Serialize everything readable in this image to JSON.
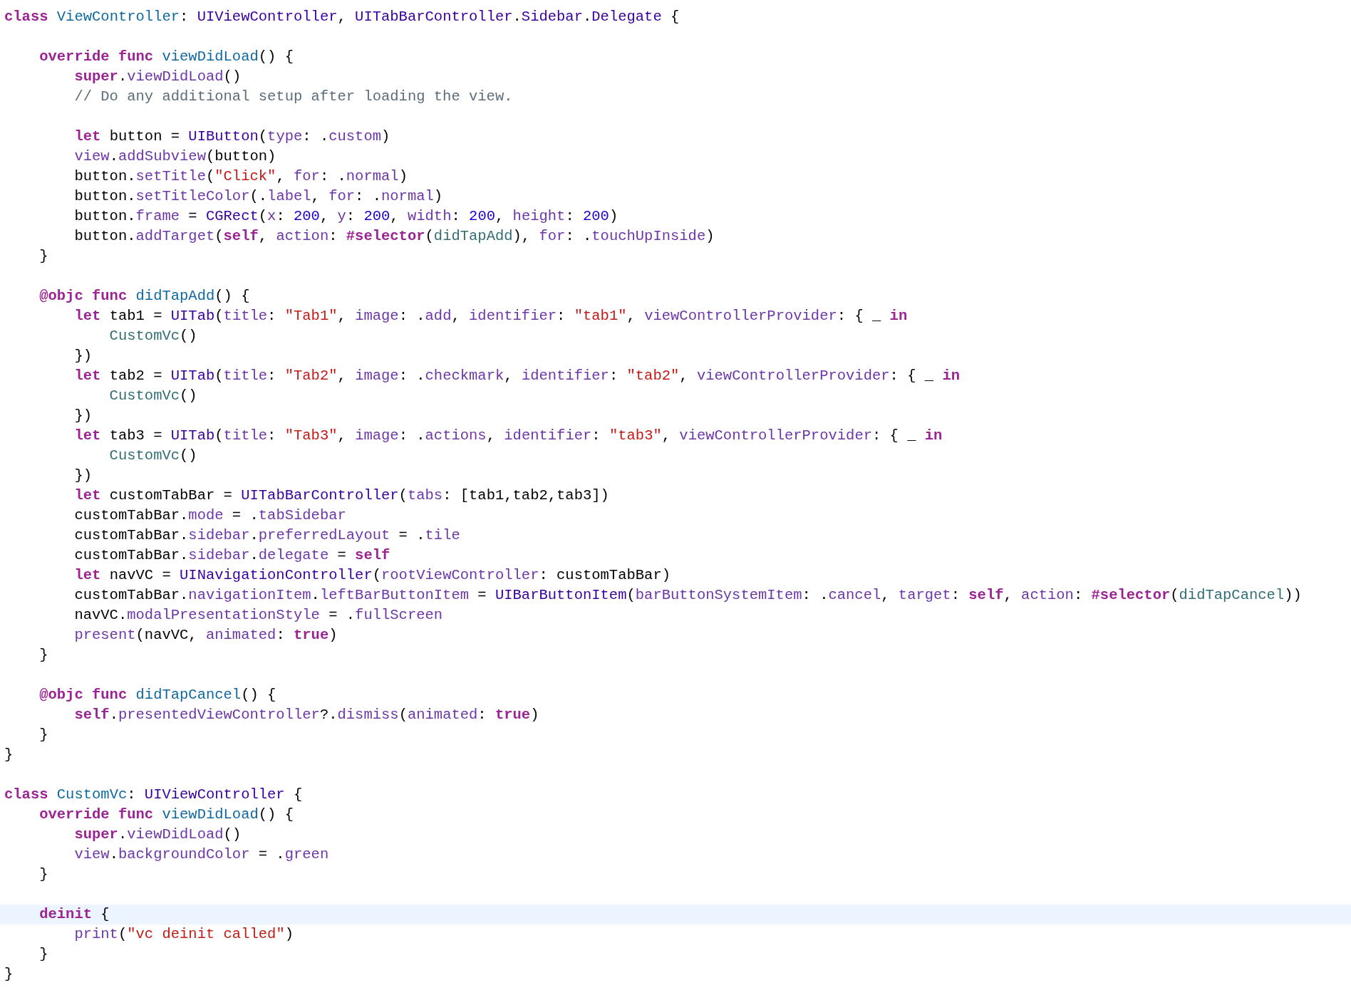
{
  "lines": [
    {
      "current": false,
      "tokens": [
        {
          "kind": "keyword",
          "text": "class"
        },
        {
          "kind": "declaration",
          "text": " ViewController"
        },
        {
          "kind": "plain",
          "text": ": "
        },
        {
          "kind": "type",
          "text": "UIViewController"
        },
        {
          "kind": "plain",
          "text": ", "
        },
        {
          "kind": "type",
          "text": "UITabBarController"
        },
        {
          "kind": "plain",
          "text": "."
        },
        {
          "kind": "type",
          "text": "Sidebar"
        },
        {
          "kind": "plain",
          "text": "."
        },
        {
          "kind": "type",
          "text": "Delegate"
        },
        {
          "kind": "plain",
          "text": " {"
        }
      ]
    },
    {
      "current": false
    },
    {
      "current": false,
      "tokens": [
        {
          "kind": "keyword",
          "text": "    override func"
        },
        {
          "kind": "declaration",
          "text": " viewDidLoad"
        },
        {
          "kind": "plain",
          "text": "() {"
        }
      ]
    },
    {
      "current": false,
      "tokens": [
        {
          "kind": "keyword",
          "text": "        super"
        },
        {
          "kind": "plain",
          "text": "."
        },
        {
          "kind": "member",
          "text": "viewDidLoad"
        },
        {
          "kind": "plain",
          "text": "()"
        }
      ]
    },
    {
      "current": false,
      "tokens": [
        {
          "kind": "comment",
          "text": "        // Do any additional setup after loading the view."
        }
      ]
    },
    {
      "current": false
    },
    {
      "current": false,
      "tokens": [
        {
          "kind": "keyword",
          "text": "        let"
        },
        {
          "kind": "plain",
          "text": " button = "
        },
        {
          "kind": "type",
          "text": "UIButton"
        },
        {
          "kind": "plain",
          "text": "("
        },
        {
          "kind": "member",
          "text": "type"
        },
        {
          "kind": "plain",
          "text": ": ."
        },
        {
          "kind": "member",
          "text": "custom"
        },
        {
          "kind": "plain",
          "text": ")"
        }
      ]
    },
    {
      "current": false,
      "tokens": [
        {
          "kind": "member",
          "text": "        view"
        },
        {
          "kind": "plain",
          "text": "."
        },
        {
          "kind": "member",
          "text": "addSubview"
        },
        {
          "kind": "plain",
          "text": "(button)"
        }
      ]
    },
    {
      "current": false,
      "tokens": [
        {
          "kind": "plain",
          "text": "        button."
        },
        {
          "kind": "member",
          "text": "setTitle"
        },
        {
          "kind": "plain",
          "text": "("
        },
        {
          "kind": "string",
          "text": "\"Click\""
        },
        {
          "kind": "plain",
          "text": ", "
        },
        {
          "kind": "member",
          "text": "for"
        },
        {
          "kind": "plain",
          "text": ": ."
        },
        {
          "kind": "member",
          "text": "normal"
        },
        {
          "kind": "plain",
          "text": ")"
        }
      ]
    },
    {
      "current": false,
      "tokens": [
        {
          "kind": "plain",
          "text": "        button."
        },
        {
          "kind": "member",
          "text": "setTitleColor"
        },
        {
          "kind": "plain",
          "text": "(."
        },
        {
          "kind": "member",
          "text": "label"
        },
        {
          "kind": "plain",
          "text": ", "
        },
        {
          "kind": "member",
          "text": "for"
        },
        {
          "kind": "plain",
          "text": ": ."
        },
        {
          "kind": "member",
          "text": "normal"
        },
        {
          "kind": "plain",
          "text": ")"
        }
      ]
    },
    {
      "current": false,
      "tokens": [
        {
          "kind": "plain",
          "text": "        button."
        },
        {
          "kind": "member",
          "text": "frame"
        },
        {
          "kind": "plain",
          "text": " = "
        },
        {
          "kind": "type",
          "text": "CGRect"
        },
        {
          "kind": "plain",
          "text": "("
        },
        {
          "kind": "member",
          "text": "x"
        },
        {
          "kind": "plain",
          "text": ": "
        },
        {
          "kind": "number",
          "text": "200"
        },
        {
          "kind": "plain",
          "text": ", "
        },
        {
          "kind": "member",
          "text": "y"
        },
        {
          "kind": "plain",
          "text": ": "
        },
        {
          "kind": "number",
          "text": "200"
        },
        {
          "kind": "plain",
          "text": ", "
        },
        {
          "kind": "member",
          "text": "width"
        },
        {
          "kind": "plain",
          "text": ": "
        },
        {
          "kind": "number",
          "text": "200"
        },
        {
          "kind": "plain",
          "text": ", "
        },
        {
          "kind": "member",
          "text": "height"
        },
        {
          "kind": "plain",
          "text": ": "
        },
        {
          "kind": "number",
          "text": "200"
        },
        {
          "kind": "plain",
          "text": ")"
        }
      ]
    },
    {
      "current": false,
      "tokens": [
        {
          "kind": "plain",
          "text": "        button."
        },
        {
          "kind": "member",
          "text": "addTarget"
        },
        {
          "kind": "plain",
          "text": "("
        },
        {
          "kind": "keyword",
          "text": "self"
        },
        {
          "kind": "plain",
          "text": ", "
        },
        {
          "kind": "member",
          "text": "action"
        },
        {
          "kind": "plain",
          "text": ": "
        },
        {
          "kind": "keyword",
          "text": "#selector"
        },
        {
          "kind": "plain",
          "text": "("
        },
        {
          "kind": "project",
          "text": "didTapAdd"
        },
        {
          "kind": "plain",
          "text": "), "
        },
        {
          "kind": "member",
          "text": "for"
        },
        {
          "kind": "plain",
          "text": ": ."
        },
        {
          "kind": "member",
          "text": "touchUpInside"
        },
        {
          "kind": "plain",
          "text": ")"
        }
      ]
    },
    {
      "current": false,
      "tokens": [
        {
          "kind": "plain",
          "text": "    }"
        }
      ]
    },
    {
      "current": false
    },
    {
      "current": false,
      "tokens": [
        {
          "kind": "keyword",
          "text": "    @objc func"
        },
        {
          "kind": "declaration",
          "text": " didTapAdd"
        },
        {
          "kind": "plain",
          "text": "() {"
        }
      ]
    },
    {
      "current": false,
      "tokens": [
        {
          "kind": "keyword",
          "text": "        let"
        },
        {
          "kind": "plain",
          "text": " tab1 = "
        },
        {
          "kind": "type",
          "text": "UITab"
        },
        {
          "kind": "plain",
          "text": "("
        },
        {
          "kind": "member",
          "text": "title"
        },
        {
          "kind": "plain",
          "text": ": "
        },
        {
          "kind": "string",
          "text": "\"Tab1\""
        },
        {
          "kind": "plain",
          "text": ", "
        },
        {
          "kind": "member",
          "text": "image"
        },
        {
          "kind": "plain",
          "text": ": ."
        },
        {
          "kind": "member",
          "text": "add"
        },
        {
          "kind": "plain",
          "text": ", "
        },
        {
          "kind": "member",
          "text": "identifier"
        },
        {
          "kind": "plain",
          "text": ": "
        },
        {
          "kind": "string",
          "text": "\"tab1\""
        },
        {
          "kind": "plain",
          "text": ", "
        },
        {
          "kind": "member",
          "text": "viewControllerProvider"
        },
        {
          "kind": "plain",
          "text": ": { _ "
        },
        {
          "kind": "keyword",
          "text": "in"
        }
      ]
    },
    {
      "current": false,
      "tokens": [
        {
          "kind": "project",
          "text": "            CustomVc"
        },
        {
          "kind": "plain",
          "text": "()"
        }
      ]
    },
    {
      "current": false,
      "tokens": [
        {
          "kind": "plain",
          "text": "        })"
        }
      ]
    },
    {
      "current": false,
      "tokens": [
        {
          "kind": "keyword",
          "text": "        let"
        },
        {
          "kind": "plain",
          "text": " tab2 = "
        },
        {
          "kind": "type",
          "text": "UITab"
        },
        {
          "kind": "plain",
          "text": "("
        },
        {
          "kind": "member",
          "text": "title"
        },
        {
          "kind": "plain",
          "text": ": "
        },
        {
          "kind": "string",
          "text": "\"Tab2\""
        },
        {
          "kind": "plain",
          "text": ", "
        },
        {
          "kind": "member",
          "text": "image"
        },
        {
          "kind": "plain",
          "text": ": ."
        },
        {
          "kind": "member",
          "text": "checkmark"
        },
        {
          "kind": "plain",
          "text": ", "
        },
        {
          "kind": "member",
          "text": "identifier"
        },
        {
          "kind": "plain",
          "text": ": "
        },
        {
          "kind": "string",
          "text": "\"tab2\""
        },
        {
          "kind": "plain",
          "text": ", "
        },
        {
          "kind": "member",
          "text": "viewControllerProvider"
        },
        {
          "kind": "plain",
          "text": ": { _ "
        },
        {
          "kind": "keyword",
          "text": "in"
        }
      ]
    },
    {
      "current": false,
      "tokens": [
        {
          "kind": "project",
          "text": "            CustomVc"
        },
        {
          "kind": "plain",
          "text": "()"
        }
      ]
    },
    {
      "current": false,
      "tokens": [
        {
          "kind": "plain",
          "text": "        })"
        }
      ]
    },
    {
      "current": false,
      "tokens": [
        {
          "kind": "keyword",
          "text": "        let"
        },
        {
          "kind": "plain",
          "text": " tab3 = "
        },
        {
          "kind": "type",
          "text": "UITab"
        },
        {
          "kind": "plain",
          "text": "("
        },
        {
          "kind": "member",
          "text": "title"
        },
        {
          "kind": "plain",
          "text": ": "
        },
        {
          "kind": "string",
          "text": "\"Tab3\""
        },
        {
          "kind": "plain",
          "text": ", "
        },
        {
          "kind": "member",
          "text": "image"
        },
        {
          "kind": "plain",
          "text": ": ."
        },
        {
          "kind": "member",
          "text": "actions"
        },
        {
          "kind": "plain",
          "text": ", "
        },
        {
          "kind": "member",
          "text": "identifier"
        },
        {
          "kind": "plain",
          "text": ": "
        },
        {
          "kind": "string",
          "text": "\"tab3\""
        },
        {
          "kind": "plain",
          "text": ", "
        },
        {
          "kind": "member",
          "text": "viewControllerProvider"
        },
        {
          "kind": "plain",
          "text": ": { _ "
        },
        {
          "kind": "keyword",
          "text": "in"
        }
      ]
    },
    {
      "current": false,
      "tokens": [
        {
          "kind": "project",
          "text": "            CustomVc"
        },
        {
          "kind": "plain",
          "text": "()"
        }
      ]
    },
    {
      "current": false,
      "tokens": [
        {
          "kind": "plain",
          "text": "        })"
        }
      ]
    },
    {
      "current": false,
      "tokens": [
        {
          "kind": "keyword",
          "text": "        let"
        },
        {
          "kind": "plain",
          "text": " customTabBar = "
        },
        {
          "kind": "type",
          "text": "UITabBarController"
        },
        {
          "kind": "plain",
          "text": "("
        },
        {
          "kind": "member",
          "text": "tabs"
        },
        {
          "kind": "plain",
          "text": ": [tab1,tab2,tab3])"
        }
      ]
    },
    {
      "current": false,
      "tokens": [
        {
          "kind": "plain",
          "text": "        customTabBar."
        },
        {
          "kind": "member",
          "text": "mode"
        },
        {
          "kind": "plain",
          "text": " = ."
        },
        {
          "kind": "member",
          "text": "tabSidebar"
        }
      ]
    },
    {
      "current": false,
      "tokens": [
        {
          "kind": "plain",
          "text": "        customTabBar."
        },
        {
          "kind": "member",
          "text": "sidebar"
        },
        {
          "kind": "plain",
          "text": "."
        },
        {
          "kind": "member",
          "text": "preferredLayout"
        },
        {
          "kind": "plain",
          "text": " = ."
        },
        {
          "kind": "member",
          "text": "tile"
        }
      ]
    },
    {
      "current": false,
      "tokens": [
        {
          "kind": "plain",
          "text": "        customTabBar."
        },
        {
          "kind": "member",
          "text": "sidebar"
        },
        {
          "kind": "plain",
          "text": "."
        },
        {
          "kind": "member",
          "text": "delegate"
        },
        {
          "kind": "plain",
          "text": " = "
        },
        {
          "kind": "keyword",
          "text": "self"
        }
      ]
    },
    {
      "current": false,
      "tokens": [
        {
          "kind": "keyword",
          "text": "        let"
        },
        {
          "kind": "plain",
          "text": " navVC = "
        },
        {
          "kind": "type",
          "text": "UINavigationController"
        },
        {
          "kind": "plain",
          "text": "("
        },
        {
          "kind": "member",
          "text": "rootViewController"
        },
        {
          "kind": "plain",
          "text": ": customTabBar)"
        }
      ]
    },
    {
      "current": false,
      "tokens": [
        {
          "kind": "plain",
          "text": "        customTabBar."
        },
        {
          "kind": "member",
          "text": "navigationItem"
        },
        {
          "kind": "plain",
          "text": "."
        },
        {
          "kind": "member",
          "text": "leftBarButtonItem"
        },
        {
          "kind": "plain",
          "text": " = "
        },
        {
          "kind": "type",
          "text": "UIBarButtonItem"
        },
        {
          "kind": "plain",
          "text": "("
        },
        {
          "kind": "member",
          "text": "barButtonSystemItem"
        },
        {
          "kind": "plain",
          "text": ": ."
        },
        {
          "kind": "member",
          "text": "cancel"
        },
        {
          "kind": "plain",
          "text": ", "
        },
        {
          "kind": "member",
          "text": "target"
        },
        {
          "kind": "plain",
          "text": ": "
        },
        {
          "kind": "keyword",
          "text": "self"
        },
        {
          "kind": "plain",
          "text": ", "
        },
        {
          "kind": "member",
          "text": "action"
        },
        {
          "kind": "plain",
          "text": ": "
        },
        {
          "kind": "keyword",
          "text": "#selector"
        },
        {
          "kind": "plain",
          "text": "("
        },
        {
          "kind": "project",
          "text": "didTapCancel"
        },
        {
          "kind": "plain",
          "text": "))"
        }
      ]
    },
    {
      "current": false,
      "tokens": [
        {
          "kind": "plain",
          "text": "        navVC."
        },
        {
          "kind": "member",
          "text": "modalPresentationStyle"
        },
        {
          "kind": "plain",
          "text": " = ."
        },
        {
          "kind": "member",
          "text": "fullScreen"
        }
      ]
    },
    {
      "current": false,
      "tokens": [
        {
          "kind": "member",
          "text": "        present"
        },
        {
          "kind": "plain",
          "text": "(navVC, "
        },
        {
          "kind": "member",
          "text": "animated"
        },
        {
          "kind": "plain",
          "text": ": "
        },
        {
          "kind": "keyword",
          "text": "true"
        },
        {
          "kind": "plain",
          "text": ")"
        }
      ]
    },
    {
      "current": false,
      "tokens": [
        {
          "kind": "plain",
          "text": "    }"
        }
      ]
    },
    {
      "current": false
    },
    {
      "current": false,
      "tokens": [
        {
          "kind": "keyword",
          "text": "    @objc func"
        },
        {
          "kind": "declaration",
          "text": " didTapCancel"
        },
        {
          "kind": "plain",
          "text": "() {"
        }
      ]
    },
    {
      "current": false,
      "tokens": [
        {
          "kind": "keyword",
          "text": "        self"
        },
        {
          "kind": "plain",
          "text": "."
        },
        {
          "kind": "member",
          "text": "presentedViewController"
        },
        {
          "kind": "plain",
          "text": "?."
        },
        {
          "kind": "member",
          "text": "dismiss"
        },
        {
          "kind": "plain",
          "text": "("
        },
        {
          "kind": "member",
          "text": "animated"
        },
        {
          "kind": "plain",
          "text": ": "
        },
        {
          "kind": "keyword",
          "text": "true"
        },
        {
          "kind": "plain",
          "text": ")"
        }
      ]
    },
    {
      "current": false,
      "tokens": [
        {
          "kind": "plain",
          "text": "    }"
        }
      ]
    },
    {
      "current": false,
      "tokens": [
        {
          "kind": "plain",
          "text": "}"
        }
      ]
    },
    {
      "current": false
    },
    {
      "current": false,
      "tokens": [
        {
          "kind": "keyword",
          "text": "class"
        },
        {
          "kind": "declaration",
          "text": " CustomVc"
        },
        {
          "kind": "plain",
          "text": ": "
        },
        {
          "kind": "type",
          "text": "UIViewController"
        },
        {
          "kind": "plain",
          "text": " {"
        }
      ]
    },
    {
      "current": false,
      "tokens": [
        {
          "kind": "keyword",
          "text": "    override func"
        },
        {
          "kind": "declaration",
          "text": " viewDidLoad"
        },
        {
          "kind": "plain",
          "text": "() {"
        }
      ]
    },
    {
      "current": false,
      "tokens": [
        {
          "kind": "keyword",
          "text": "        super"
        },
        {
          "kind": "plain",
          "text": "."
        },
        {
          "kind": "member",
          "text": "viewDidLoad"
        },
        {
          "kind": "plain",
          "text": "()"
        }
      ]
    },
    {
      "current": false,
      "tokens": [
        {
          "kind": "member",
          "text": "        view"
        },
        {
          "kind": "plain",
          "text": "."
        },
        {
          "kind": "member",
          "text": "backgroundColor"
        },
        {
          "kind": "plain",
          "text": " = ."
        },
        {
          "kind": "member",
          "text": "green"
        }
      ]
    },
    {
      "current": false,
      "tokens": [
        {
          "kind": "plain",
          "text": "    }"
        }
      ]
    },
    {
      "current": false
    },
    {
      "current": true,
      "tokens": [
        {
          "kind": "keyword",
          "text": "    deinit"
        },
        {
          "kind": "plain",
          "text": " {"
        }
      ]
    },
    {
      "current": false,
      "tokens": [
        {
          "kind": "member",
          "text": "        print"
        },
        {
          "kind": "plain",
          "text": "("
        },
        {
          "kind": "string",
          "text": "\"vc deinit called\""
        },
        {
          "kind": "plain",
          "text": ")"
        }
      ]
    },
    {
      "current": false,
      "tokens": [
        {
          "kind": "plain",
          "text": "    }"
        }
      ]
    },
    {
      "current": false,
      "tokens": [
        {
          "kind": "plain",
          "text": "}"
        }
      ]
    }
  ]
}
